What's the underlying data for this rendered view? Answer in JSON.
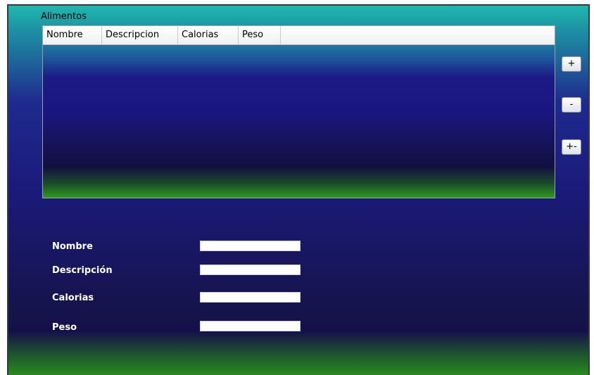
{
  "group": {
    "title": "Alimentos"
  },
  "grid": {
    "columns": [
      "Nombre",
      "Descripcion",
      "Calorias",
      "Peso"
    ],
    "rows": []
  },
  "buttons": {
    "add": "+",
    "remove": "-",
    "toggle": "+-"
  },
  "form": {
    "fields": [
      {
        "label": "Nombre",
        "value": ""
      },
      {
        "label": "Descripción",
        "value": ""
      },
      {
        "label": "Calorias",
        "value": ""
      },
      {
        "label": "Peso",
        "value": ""
      }
    ]
  }
}
